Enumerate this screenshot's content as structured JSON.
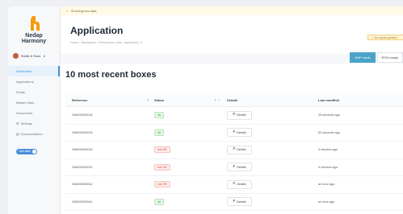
{
  "banner": {
    "icon": "warning-icon",
    "text": "Showing test data"
  },
  "brand": {
    "line1": "Nedap",
    "line2": "Harmony",
    "accent": "#f39c12"
  },
  "company": {
    "name": "Smith & Sons"
  },
  "nav": [
    {
      "label": "Dashboard",
      "active": true,
      "icon": ""
    },
    {
      "label": "Applications",
      "active": false,
      "icon": ""
    },
    {
      "label": "Floats",
      "active": false,
      "icon": ""
    },
    {
      "label": "Master Data",
      "active": false,
      "icon": ""
    },
    {
      "label": "Documents",
      "active": false,
      "icon": ""
    },
    {
      "label": "Settings",
      "active": false,
      "icon": "gear-icon"
    },
    {
      "label": "Documentation",
      "active": false,
      "icon": "book-icon"
    }
  ],
  "toggle": {
    "label": "test data"
  },
  "page": {
    "title": "Application",
    "breadcrumb": "Home  ›  Backpacks  ›  Warehouse units  ›  Application ∨",
    "feedback": "Do a quick question"
  },
  "tabs": [
    {
      "label": "UHF reads",
      "active": true
    },
    {
      "label": "RSSI reads",
      "active": false
    }
  ],
  "card": {
    "title": "10 most recent boxes"
  },
  "table": {
    "headers": {
      "reference": "Reference",
      "status": "Status",
      "details": "Details",
      "modified": "Last modified"
    },
    "details_label": "Details",
    "rows": [
      {
        "reference": "DWA00000034",
        "status": "ok",
        "modified": "33 seconds ago"
      },
      {
        "reference": "DWA00000033",
        "status": "ok",
        "modified": "52 seconds ago"
      },
      {
        "reference": "DWA00000032",
        "status": "not OK",
        "modified": "3 minutes ago"
      },
      {
        "reference": "DWA00000031",
        "status": "not OK",
        "modified": "4 minutes ago"
      },
      {
        "reference": "DWA00000042",
        "status": "not OK",
        "modified": "an hour ago"
      },
      {
        "reference": "DWA00000041",
        "status": "ok",
        "modified": "an hour ago"
      }
    ]
  }
}
